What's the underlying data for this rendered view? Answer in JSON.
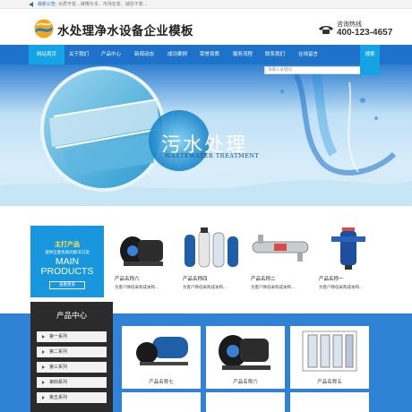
{
  "topbar": {
    "notice_label": "最新公告:",
    "notice_text": "水质不变...谁懂为本、市场在变、诚信不变..."
  },
  "header": {
    "site_title": "水处理净水设备企业模板",
    "hotline_label": "咨询热线",
    "hotline_number": "400-123-4657"
  },
  "nav": {
    "items": [
      "网站首页",
      "关于我们",
      "产品中心",
      "新闻动态",
      "成功案例",
      "荣誉资质",
      "服务流程",
      "联系我们",
      "在线留言"
    ],
    "active_index": 0
  },
  "search": {
    "placeholder": "请输入关键词",
    "button": "搜索"
  },
  "banner": {
    "title": "污水处理",
    "subtitle": "WASTEWATER TREATMENT"
  },
  "promo": {
    "title": "主打产品",
    "subtitle": "提供全套优质的解决方案",
    "main_line1": "MAIN",
    "main_line2": "PRODUCTS",
    "button": "查看更多"
  },
  "featured": [
    {
      "name": "产品名称六",
      "desc": "为客户降低采购成本和..."
    },
    {
      "name": "产品名称四",
      "desc": "为客户降低采购成本和..."
    },
    {
      "name": "产品名称二",
      "desc": "为客户降低采购成本和..."
    },
    {
      "name": "产品名称一",
      "desc": "为客户降低采购成本和..."
    }
  ],
  "sidebar": {
    "title": "产品中心",
    "items": [
      "第一系列",
      "第二系列",
      "第三系列",
      "第四系列",
      "第五系列"
    ]
  },
  "products": [
    {
      "name": "产品名称七"
    },
    {
      "name": "产品名称六"
    },
    {
      "name": "产品名称五"
    }
  ],
  "colors": {
    "nav": "#1f72c9",
    "accent": "#14a4e6",
    "promo": "#1897de",
    "footer_band": "#2f82d6",
    "sidebar": "#2b2b2b"
  }
}
